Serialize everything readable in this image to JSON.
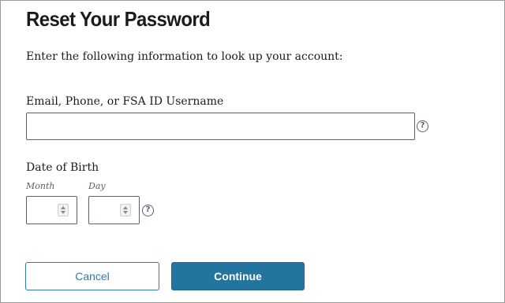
{
  "page": {
    "title": "Reset Your Password",
    "intro": "Enter the following information to look up your account:"
  },
  "form": {
    "email": {
      "label": "Email, Phone, or FSA ID Username",
      "value": "",
      "help_icon": "question-circle-icon"
    },
    "dob": {
      "label": "Date of Birth",
      "month_label": "Month",
      "day_label": "Day",
      "month_value": "",
      "day_value": "",
      "help_icon": "question-circle-icon"
    }
  },
  "actions": {
    "cancel_label": "Cancel",
    "continue_label": "Continue"
  },
  "colors": {
    "primary": "#2474a0",
    "outline": "#2b7ea8",
    "text": "#1b1b1b"
  }
}
